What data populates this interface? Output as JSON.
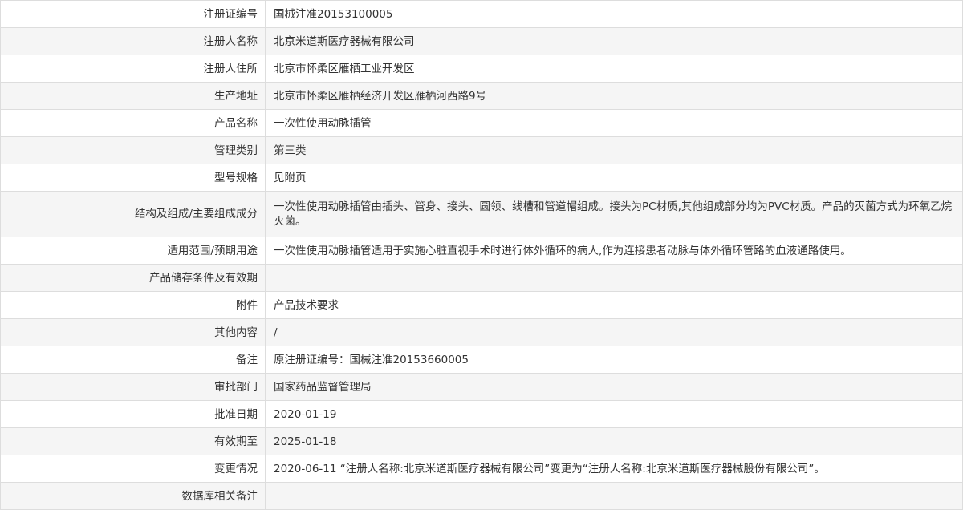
{
  "rows": [
    {
      "label": "注册证编号",
      "value": "国械注准20153100005"
    },
    {
      "label": "注册人名称",
      "value": "北京米道斯医疗器械有限公司"
    },
    {
      "label": "注册人住所",
      "value": "北京市怀柔区雁栖工业开发区"
    },
    {
      "label": "生产地址",
      "value": "北京市怀柔区雁栖经济开发区雁栖河西路9号"
    },
    {
      "label": "产品名称",
      "value": "一次性使用动脉插管"
    },
    {
      "label": "管理类别",
      "value": "第三类"
    },
    {
      "label": "型号规格",
      "value": "见附页"
    },
    {
      "label": "结构及组成/主要组成成分",
      "value": "一次性使用动脉插管由插头、管身、接头、圆领、线槽和管道帽组成。接头为PC材质,其他组成部分均为PVC材质。产品的灭菌方式为环氧乙烷灭菌。"
    },
    {
      "label": "适用范围/预期用途",
      "value": "一次性使用动脉插管适用于实施心脏直视手术时进行体外循环的病人,作为连接患者动脉与体外循环管路的血液通路使用。"
    },
    {
      "label": "产品储存条件及有效期",
      "value": ""
    },
    {
      "label": "附件",
      "value": "产品技术要求"
    },
    {
      "label": "其他内容",
      "value": "/"
    },
    {
      "label": "备注",
      "value": "原注册证编号：国械注准20153660005"
    },
    {
      "label": "审批部门",
      "value": "国家药品监督管理局"
    },
    {
      "label": "批准日期",
      "value": "2020-01-19"
    },
    {
      "label": "有效期至",
      "value": "2025-01-18"
    },
    {
      "label": "变更情况",
      "value": "2020-06-11 “注册人名称:北京米道斯医疗器械有限公司”变更为“注册人名称:北京米道斯医疗器械股份有限公司”。"
    },
    {
      "label": "数据库相关备注",
      "value": ""
    }
  ]
}
